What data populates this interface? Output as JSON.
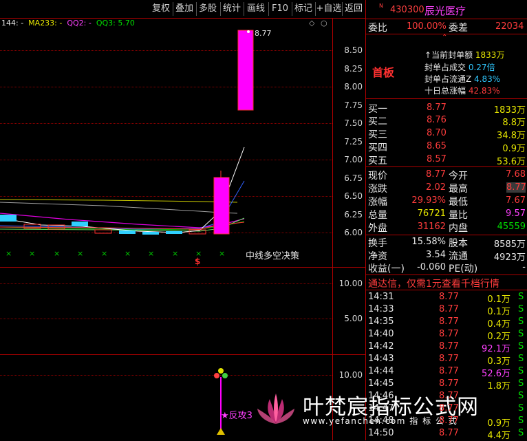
{
  "toolbar": {
    "buttons": [
      "复权",
      "叠加",
      "多股",
      "统计",
      "画线",
      "F10",
      "标记",
      "+自选",
      "返回"
    ]
  },
  "indicator_legend": {
    "ma144": "144: -",
    "ma233": "MA233: -",
    "qq2": "QQ2: -",
    "qq3": "QQ3: 5.70"
  },
  "price_axis": [
    "8.50",
    "8.25",
    "8.00",
    "7.75",
    "7.50",
    "7.25",
    "7.00",
    "6.75",
    "6.50",
    "6.25",
    "6.00"
  ],
  "mid_axis": [
    "10.00",
    "5.00"
  ],
  "low_axis": [
    "10.00"
  ],
  "candle_label": "8.77",
  "strategy_label": "中线多空决策",
  "strategy_marker": "$",
  "attack_label": "★反攻3",
  "watermark": {
    "main": "叶梵宸指标公式网",
    "url": "www.yefanchen.com 指 标 公 式"
  },
  "stock": {
    "badge": "N",
    "code": "430300",
    "name": "辰光医疗"
  },
  "weibi": {
    "label1": "委比",
    "value1": "100.00%",
    "label2": "委差",
    "value2": "22034"
  },
  "limit_info": {
    "title": "首板",
    "rows": [
      {
        "label": "当前封单额",
        "value": "1833万"
      },
      {
        "label": "封单占成交",
        "value": "0.27倍"
      },
      {
        "label": "封单占流通Z",
        "value": "4.83%"
      },
      {
        "label": "十日总涨幅",
        "value": "42.83%"
      }
    ]
  },
  "order_book": [
    {
      "label": "买一",
      "price": "8.77",
      "volume": "1833万"
    },
    {
      "label": "买二",
      "price": "8.76",
      "volume": "8.8万"
    },
    {
      "label": "买三",
      "price": "8.70",
      "volume": "34.8万"
    },
    {
      "label": "买四",
      "price": "8.65",
      "volume": "0.9万"
    },
    {
      "label": "买五",
      "price": "8.57",
      "volume": "53.6万"
    }
  ],
  "quote": {
    "rows": [
      {
        "l1": "现价",
        "v1": "8.77",
        "l2": "今开",
        "v2": "7.68"
      },
      {
        "l1": "涨跌",
        "v1": "2.02",
        "l2": "最高",
        "v2": "8.77"
      },
      {
        "l1": "涨幅",
        "v1": "29.93%",
        "l2": "最低",
        "v2": "7.67"
      },
      {
        "l1": "总量",
        "v1": "76721",
        "l2": "量比",
        "v2": "9.57"
      },
      {
        "l1": "外盘",
        "v1": "31162",
        "l2": "内盘",
        "v2": "45559"
      }
    ]
  },
  "fundamentals": {
    "rows": [
      {
        "l1": "换手",
        "v1": "15.58%",
        "l2": "股本",
        "v2": "8585万"
      },
      {
        "l1": "净资",
        "v1": "3.54",
        "l2": "流通",
        "v2": "4923万"
      },
      {
        "l1": "收益(一)",
        "v1": "-0.060",
        "l2": "PE(动)",
        "v2": "-"
      }
    ]
  },
  "promo": "通达信，仅需1元查看千档行情",
  "trades": [
    {
      "time": "14:31",
      "price": "8.77",
      "vol": "0.1万",
      "side": "S"
    },
    {
      "time": "14:33",
      "price": "8.77",
      "vol": "0.1万",
      "side": "S"
    },
    {
      "time": "14:35",
      "price": "8.77",
      "vol": "0.4万",
      "side": "S"
    },
    {
      "time": "14:40",
      "price": "8.77",
      "vol": "0.2万",
      "side": "S"
    },
    {
      "time": "14:42",
      "price": "8.77",
      "vol": "92.1万",
      "side": "S"
    },
    {
      "time": "14:43",
      "price": "8.77",
      "vol": "0.3万",
      "side": "S"
    },
    {
      "time": "14:44",
      "price": "8.77",
      "vol": "52.6万",
      "side": "S"
    },
    {
      "time": "14:45",
      "price": "8.77",
      "vol": "1.8万",
      "side": "S"
    },
    {
      "time": "14:46",
      "price": "8.77",
      "vol": "",
      "side": "S"
    },
    {
      "time": "14:47",
      "price": "8.77",
      "vol": "",
      "side": "S"
    },
    {
      "time": "14:48",
      "price": "8.77",
      "vol": "0.9万",
      "side": "S"
    },
    {
      "time": "14:50",
      "price": "8.77",
      "vol": "4.4万",
      "side": "S"
    }
  ],
  "colors": {
    "up": "#ff3c3c",
    "down": "#00e000",
    "magenta": "#ff00ff",
    "axis": "#b00000"
  }
}
